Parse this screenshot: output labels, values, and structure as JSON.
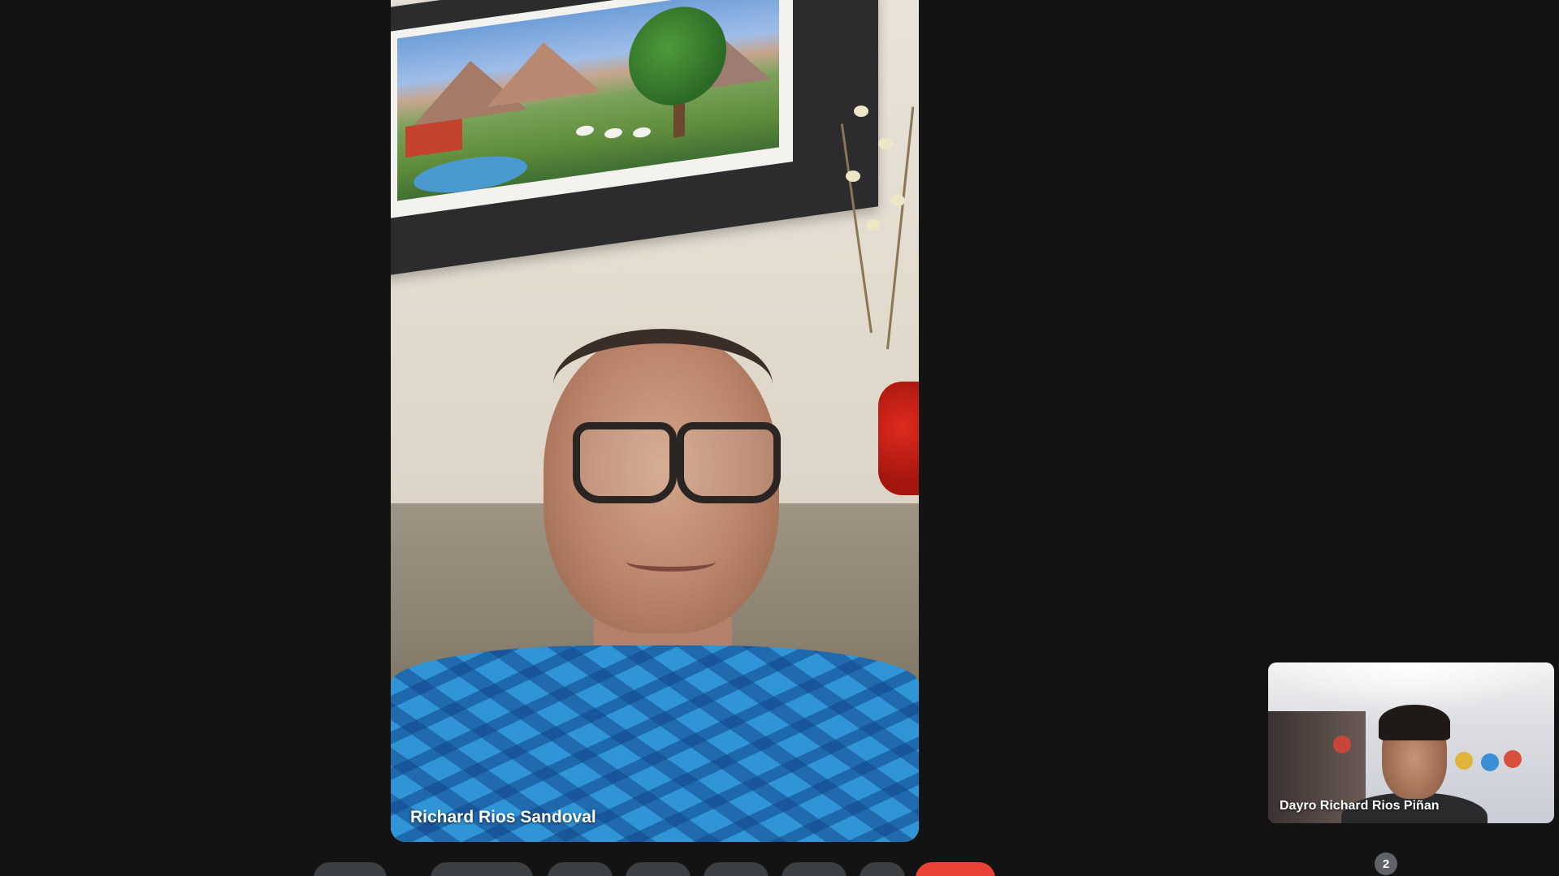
{
  "main_participant": {
    "name": "Richard Rios Sandoval"
  },
  "self_view": {
    "name": "Dayro Richard Rios Piñan"
  },
  "participant_badge": {
    "count": "2"
  },
  "controls": {
    "buttons": [
      {
        "name": "microphone-button"
      },
      {
        "name": "camera-button"
      },
      {
        "name": "captions-button"
      },
      {
        "name": "raise-hand-button"
      },
      {
        "name": "present-button"
      },
      {
        "name": "reactions-button"
      },
      {
        "name": "more-options-button"
      },
      {
        "name": "end-call-button"
      }
    ],
    "end_call_color": "#ea4335"
  },
  "colors": {
    "background": "#131313",
    "control_button": "#3c4043"
  }
}
